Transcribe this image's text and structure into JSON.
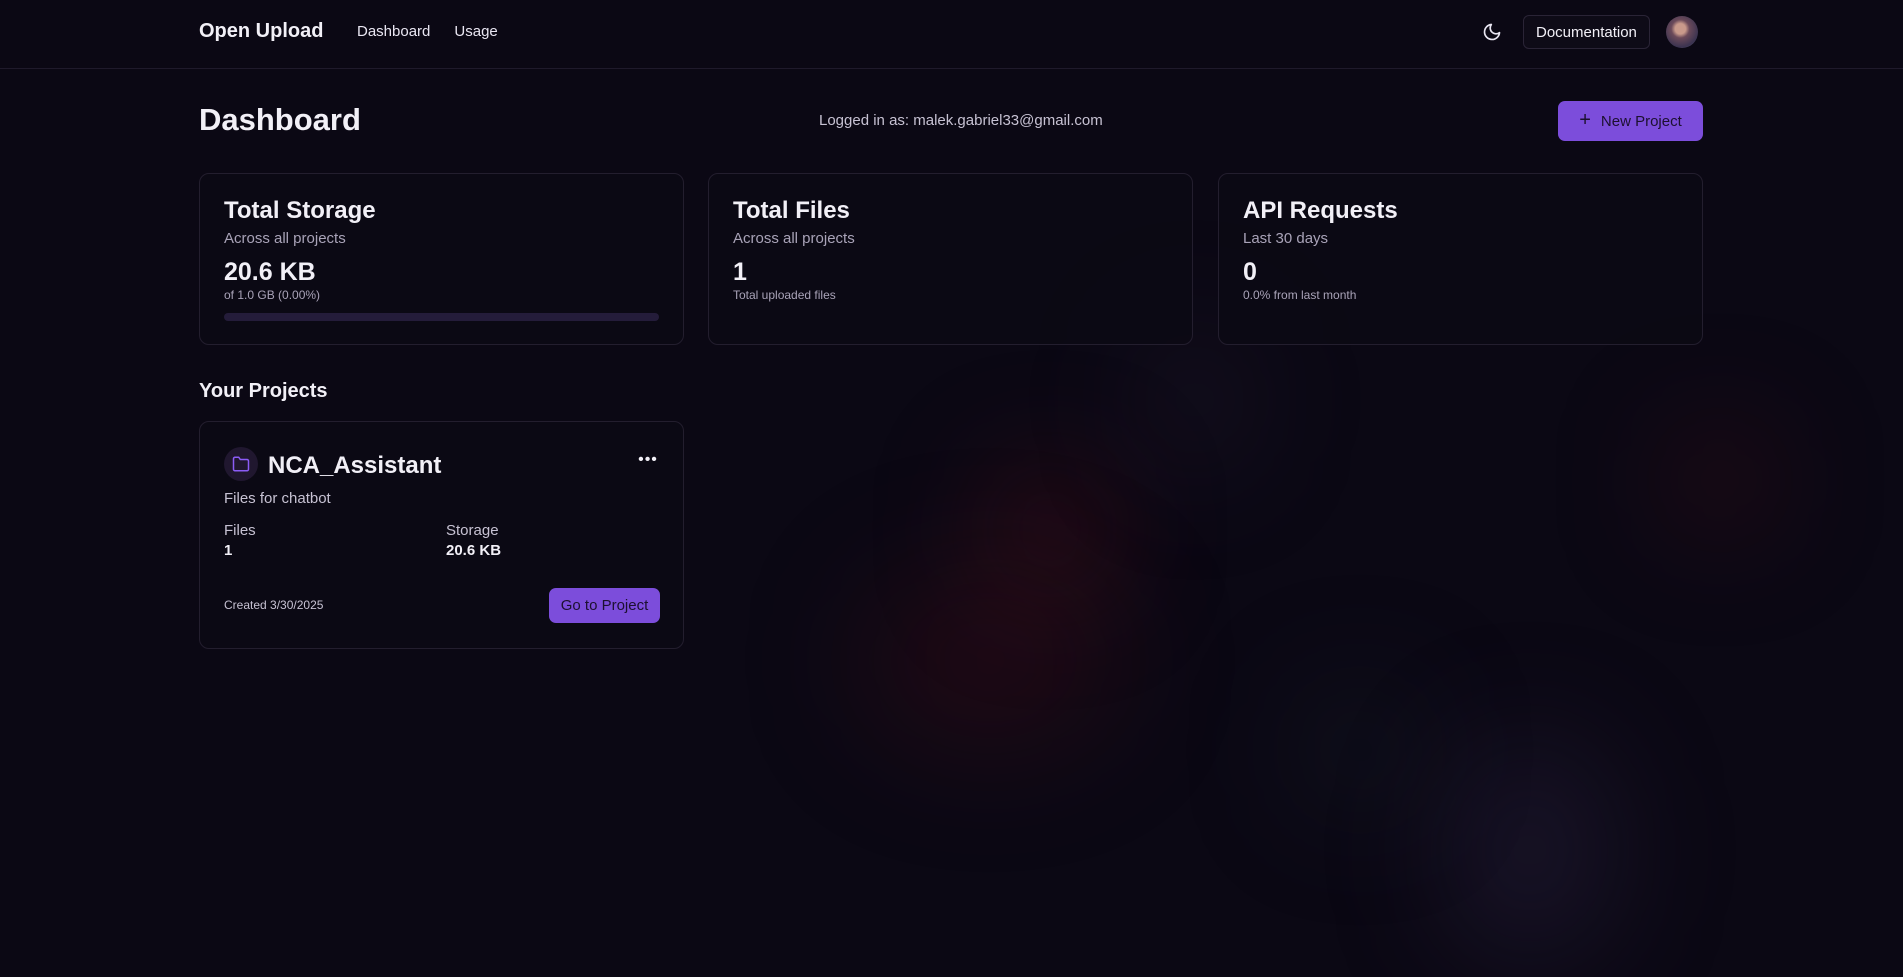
{
  "brand": "Open Upload",
  "nav": [
    {
      "label": "Dashboard"
    },
    {
      "label": "Usage"
    }
  ],
  "header": {
    "theme_icon": "moon-icon",
    "documentation_label": "Documentation",
    "avatar_icon": "user-avatar"
  },
  "page": {
    "title": "Dashboard",
    "logged_in_text": "Logged in as: malek.gabriel33@gmail.com",
    "new_project_label": "New Project",
    "new_project_icon": "plus-icon"
  },
  "stats": [
    {
      "title": "Total Storage",
      "subtitle": "Across all projects",
      "value": "20.6 KB",
      "note": "of 1.0 GB (0.00%)",
      "progress": 0.0
    },
    {
      "title": "Total Files",
      "subtitle": "Across all projects",
      "value": "1",
      "note": "Total uploaded files"
    },
    {
      "title": "API Requests",
      "subtitle": "Last 30 days",
      "value": "0",
      "note": "0.0% from last month"
    }
  ],
  "projects_section": {
    "title": "Your Projects",
    "items": [
      {
        "name": "NCA_Assistant",
        "icon": "folder-icon",
        "menu_icon": "more-horizontal-icon",
        "description": "Files for chatbot",
        "files_label": "Files",
        "files_value": "1",
        "storage_label": "Storage",
        "storage_value": "20.6 KB",
        "created": "Created 3/30/2025",
        "button_label": "Go to Project"
      }
    ]
  },
  "colors": {
    "background": "#0b0814",
    "accent": "#7c4ddb",
    "card_border": "#231e2e"
  }
}
